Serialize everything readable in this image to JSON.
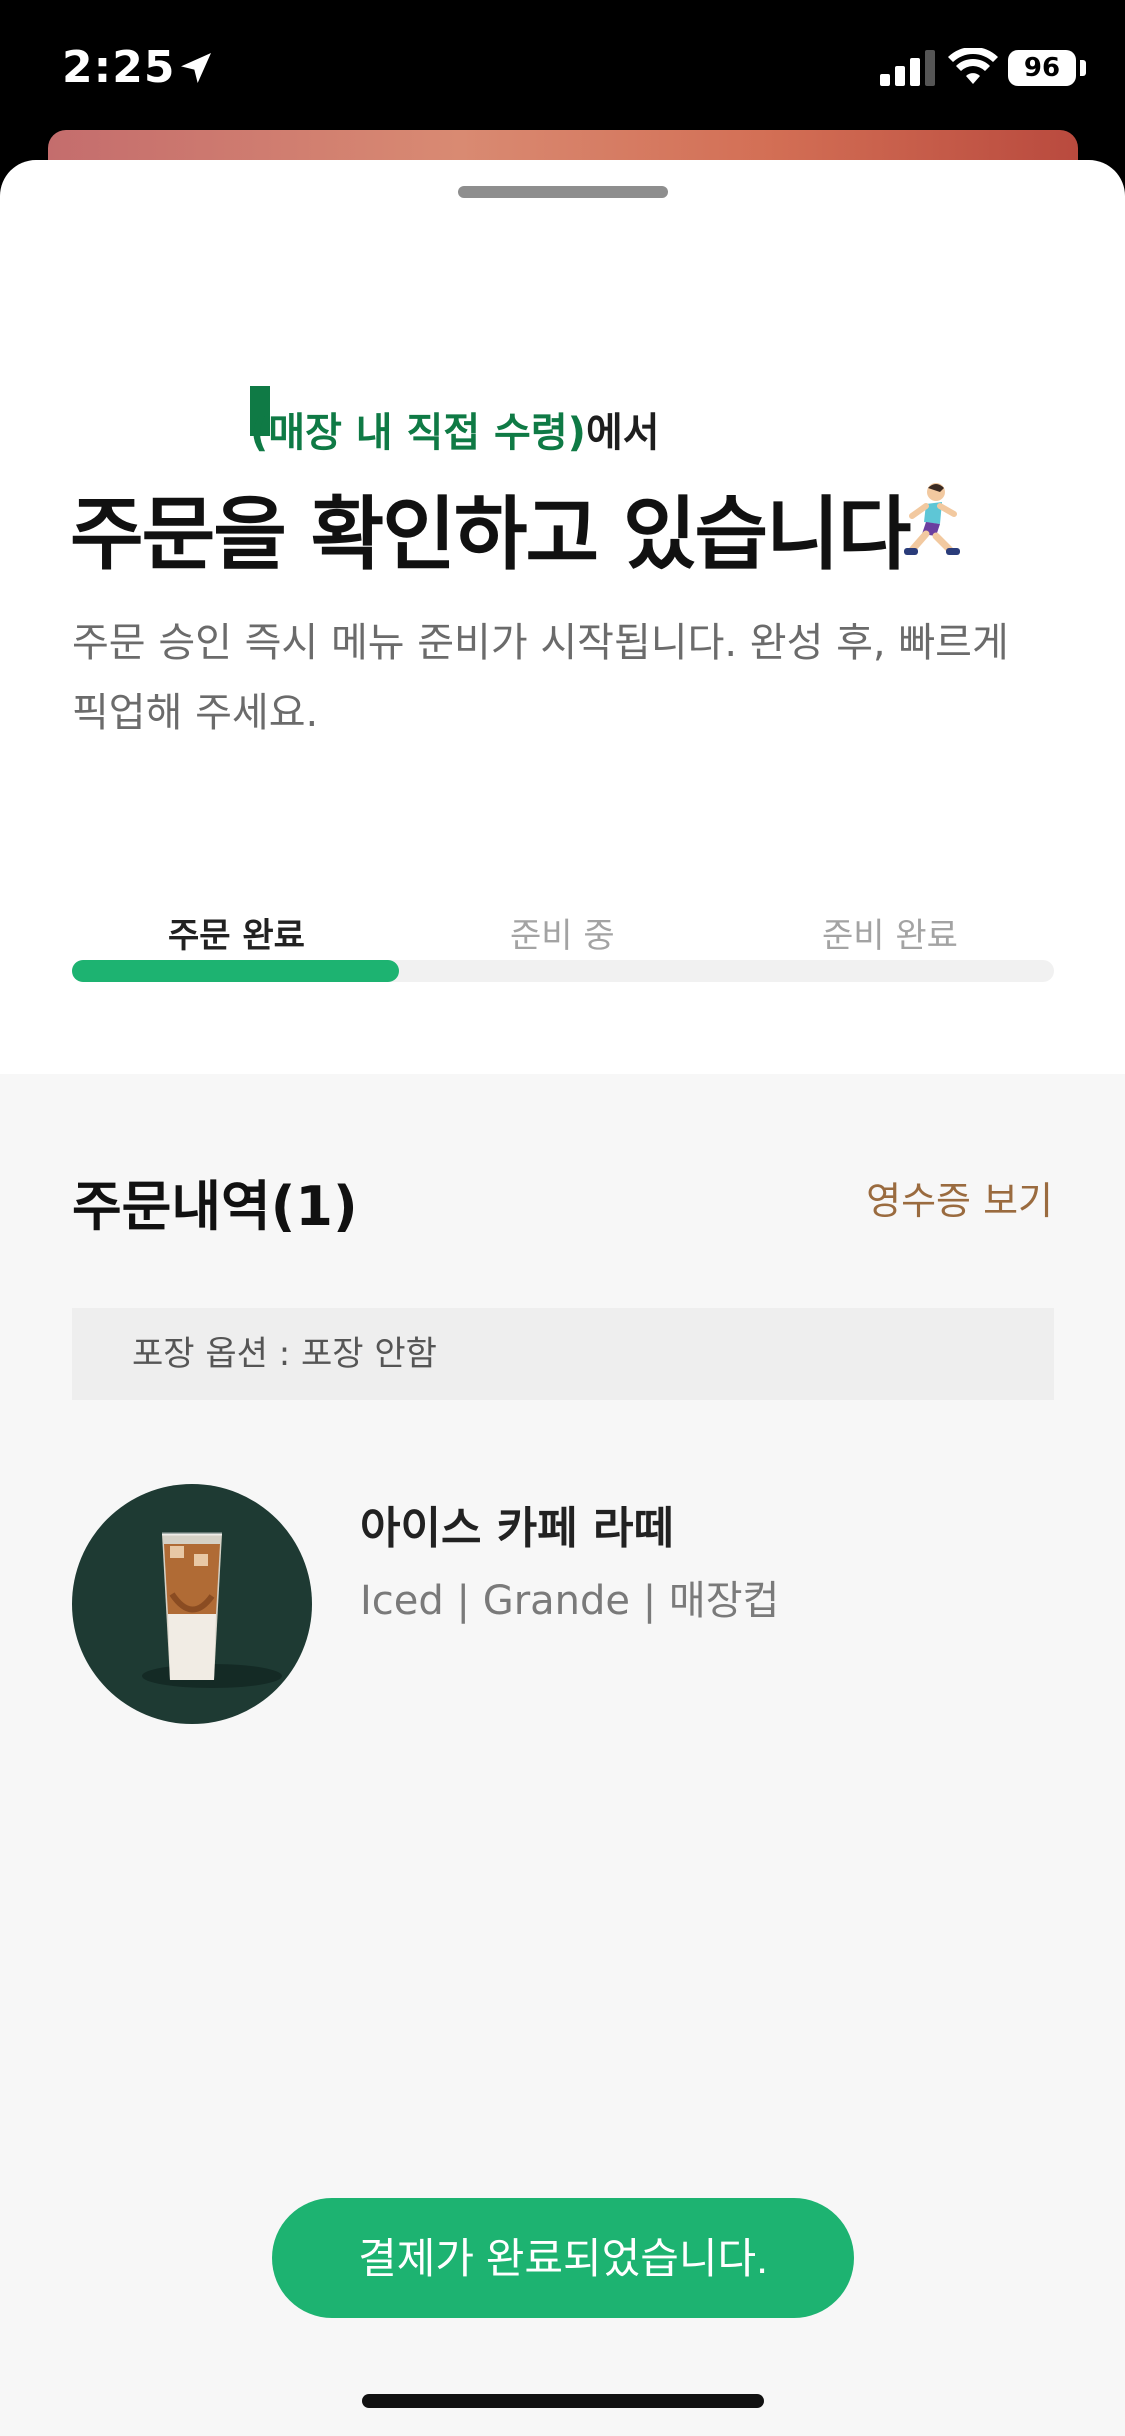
{
  "status_bar": {
    "time": "2:25",
    "battery": "96"
  },
  "header": {
    "store_name": "",
    "store_suffix": "(매장 내 직접 수령)",
    "store_tail": "에서",
    "headline": "주문을 확인하고 있습니다",
    "description": "주문 승인 즉시 메뉴 준비가 시작됩니다. 완성 후, 빠르게 픽업해 주세요."
  },
  "progress": {
    "steps": [
      "주문 완료",
      "준비 중",
      "준비 완료"
    ],
    "active_index": 0,
    "fraction": 0.333
  },
  "order": {
    "title": "주문내역(1)",
    "receipt_link": "영수증 보기",
    "pack_option": "포장 옵션 : 포장 안함",
    "items": [
      {
        "name": "아이스 카페 라떼",
        "options": "Iced | Grande | 매장컵"
      }
    ]
  },
  "payment_status": "결제가 완료되었습니다.",
  "colors": {
    "accent_green": "#1db371",
    "store_green": "#0f7a45",
    "receipt_brown": "#9a6b3f"
  },
  "icons": [
    "location-arrow-icon",
    "signal-icon",
    "wifi-icon",
    "battery-icon",
    "runner-emoji-icon"
  ]
}
